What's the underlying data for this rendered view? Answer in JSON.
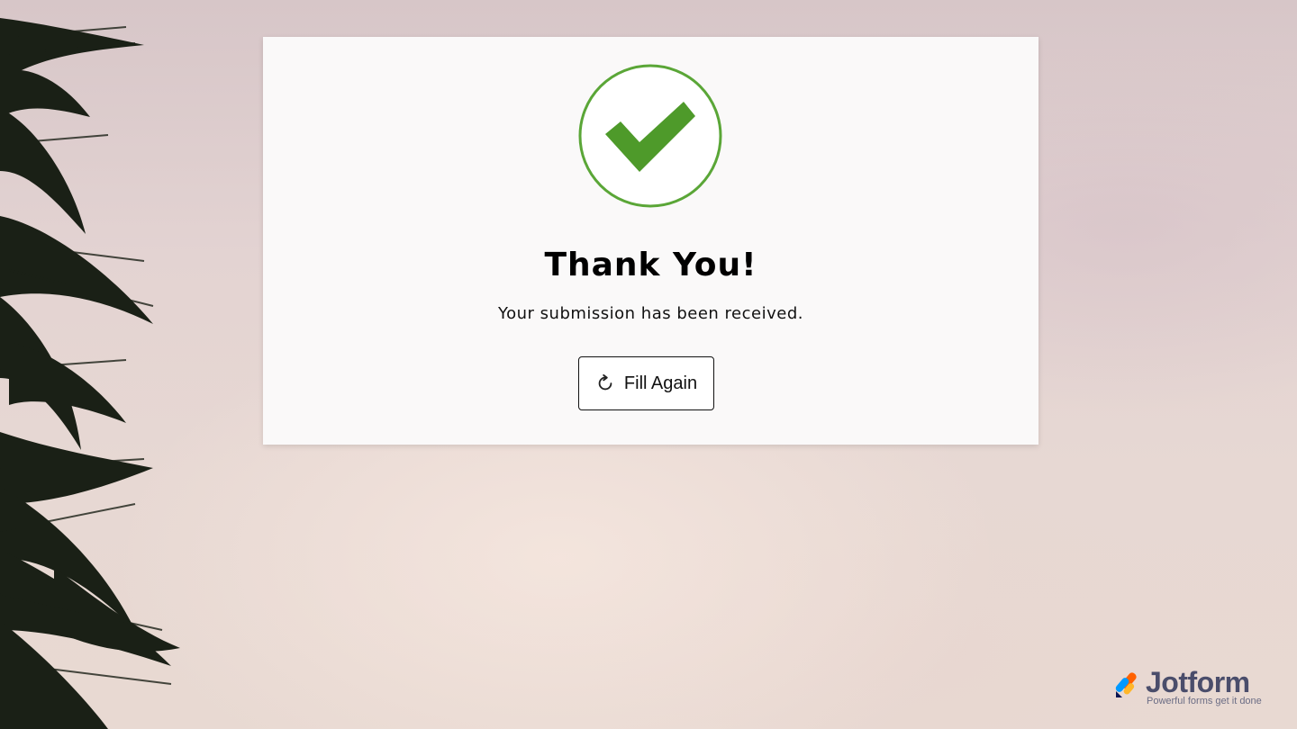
{
  "card": {
    "title": "Thank You!",
    "message": "Your submission has been received.",
    "fill_again_label": "Fill Again",
    "check_icon": "check-circle-icon",
    "refresh_icon": "refresh-icon"
  },
  "branding": {
    "name": "Jotform",
    "tagline": "Powerful forms get it done",
    "logo_icon": "jotform-logo-icon"
  },
  "colors": {
    "success_green": "#529e2f",
    "brand_text": "#4a4d6b"
  }
}
